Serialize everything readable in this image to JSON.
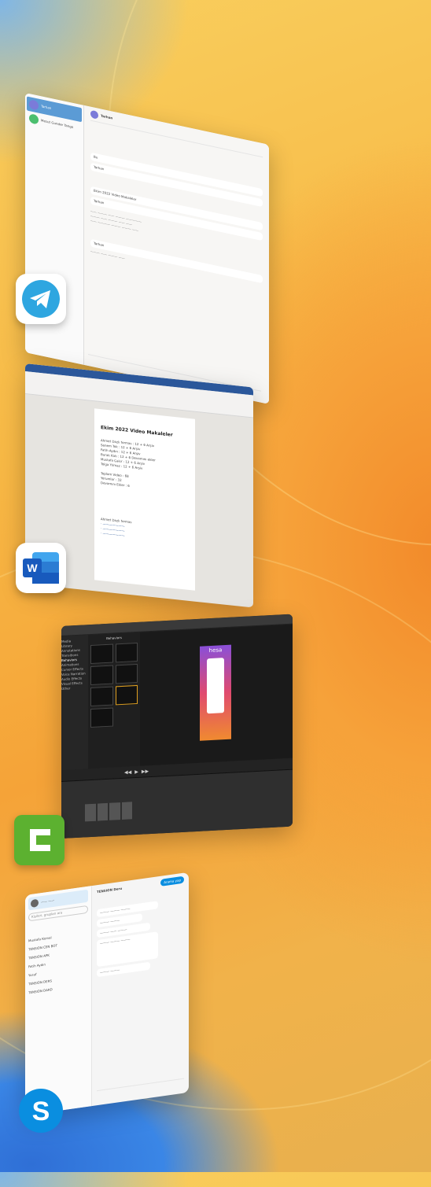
{
  "windows": {
    "telegram": {
      "app": "Telegram",
      "chats": [
        {
          "name": "Tarhan",
          "preview": "..."
        },
        {
          "name": "Mesut Gunder Tango",
          "preview": "..."
        }
      ],
      "header_name": "Tarhan",
      "messages": [
        "Bu",
        "Tarhan",
        "Ekim 2022 Video Makaleler",
        "Tarhan",
        "Tarhan"
      ]
    },
    "word": {
      "app": "Word",
      "doc_heading": "Ekim 2022 Video Makaleler",
      "lines": [
        "Ahmet Dazlı formas : 12 + 6 Arşiv",
        "Senem Tok  : 12 + 6 Arşiv",
        "Fatih Aydın : 12 + 6 Arşiv",
        "Burak Katı : 12 + 6 Devamını ekler",
        "Mustafa Çakır : 12 + 6 Arşiv",
        "Tolga Yılmaz : 12 + 6 Arşiv"
      ],
      "totals": [
        "Toplam Video : 68",
        "Yorumlar : 32",
        "Devamını Ekler : 6"
      ],
      "footer_title": "Ahmet Dazlı formas"
    },
    "camtasia": {
      "app": "Camtasia",
      "panel_title": "Behaviors",
      "sidebar": [
        "Media",
        "Library",
        "Annotations",
        "Transitions",
        "Behaviors",
        "Animations",
        "Cursor Effects",
        "Voice Narration",
        "Audio Effects",
        "Visual Effects",
        "Other"
      ],
      "preview_text": "hesa"
    },
    "skype": {
      "app": "Skype",
      "header_title": "TENSION Deru",
      "search_placeholder": "Kişileri, grupları ara",
      "chats": [
        {
          "name": "Mustafa Kemal",
          "preview": "Bugün"
        },
        {
          "name": "TENSION CEN BOT",
          "preview": "..."
        },
        {
          "name": "TENSION APK",
          "preview": "..."
        },
        {
          "name": "Fatih Aydın",
          "preview": "..."
        },
        {
          "name": "Yusuf",
          "preview": "..."
        },
        {
          "name": "TENSION DERS",
          "preview": "..."
        },
        {
          "name": "TENSION DARD",
          "preview": "..."
        }
      ],
      "call_button": "Arama yap"
    }
  },
  "colors": {
    "telegram": "#2ea6e0",
    "word": "#2b579a",
    "camtasia": "#5cb130",
    "skype": "#0a8ee0"
  }
}
